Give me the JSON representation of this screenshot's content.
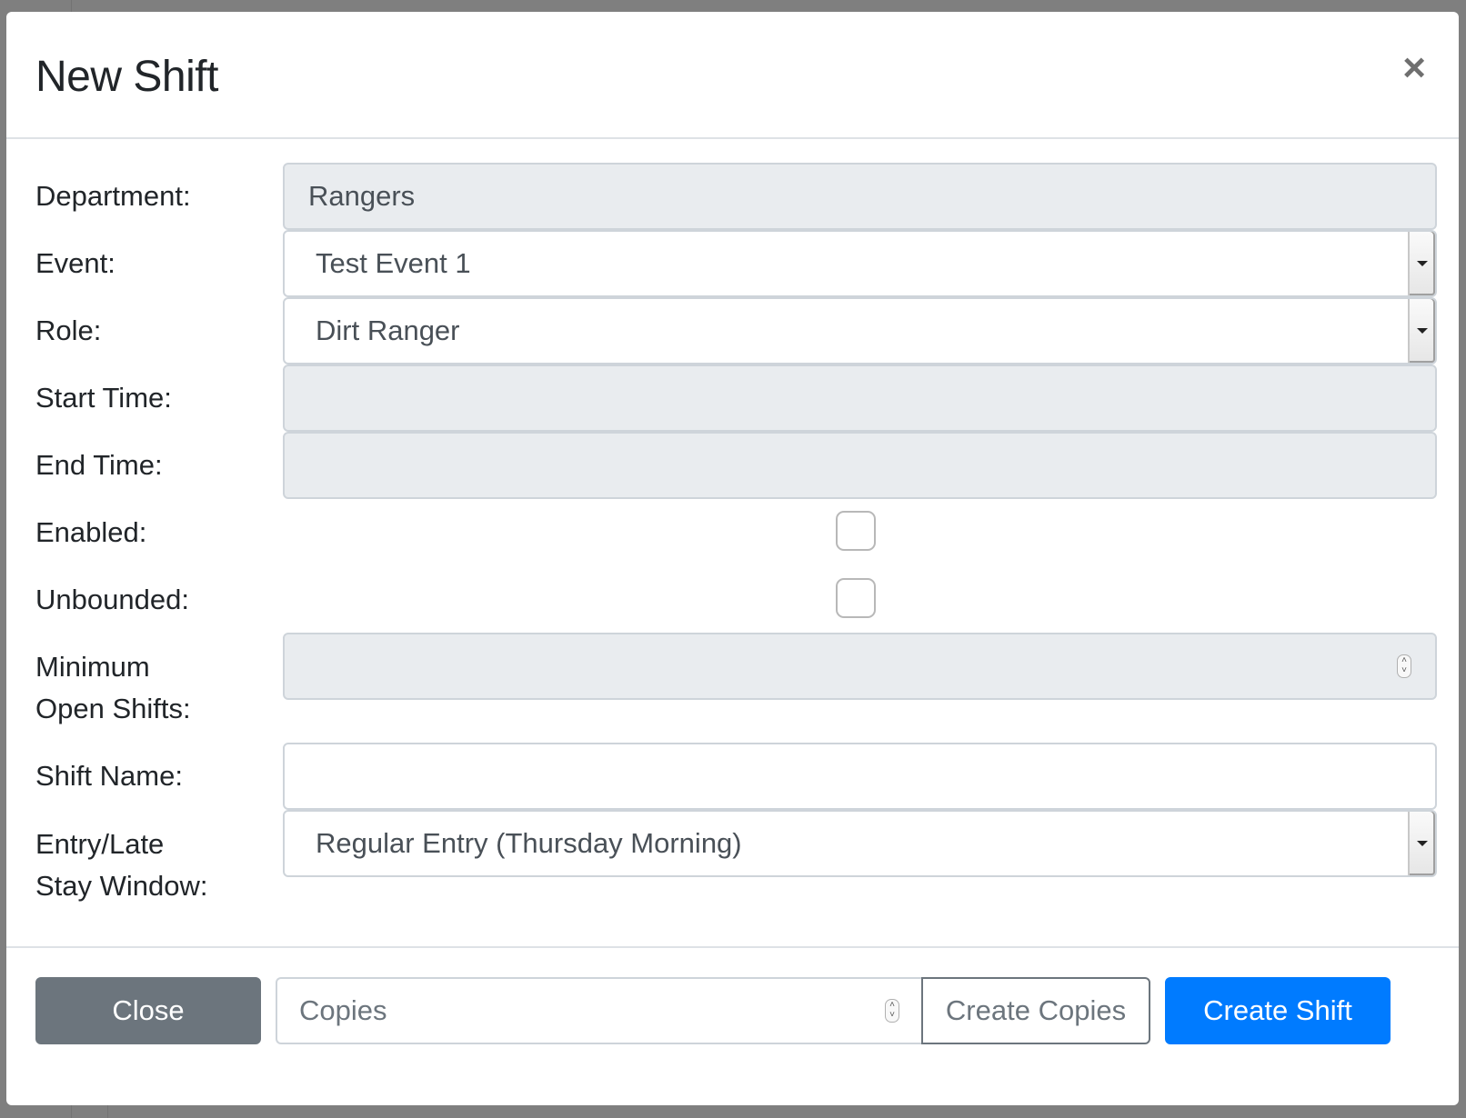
{
  "modal": {
    "title": "New Shift",
    "close_glyph": "×"
  },
  "form": {
    "department": {
      "label": "Department:",
      "value": "Rangers"
    },
    "event": {
      "label": "Event:",
      "value": "Test Event 1"
    },
    "role": {
      "label": "Role:",
      "value": "Dirt Ranger"
    },
    "start_time": {
      "label": "Start Time:",
      "value": ""
    },
    "end_time": {
      "label": "End Time:",
      "value": ""
    },
    "enabled": {
      "label": "Enabled:",
      "checked": false
    },
    "unbounded": {
      "label": "Unbounded:",
      "checked": false
    },
    "minimum_open_shifts": {
      "label_line1": "Minimum",
      "label_line2": "Open Shifts:",
      "value": ""
    },
    "shift_name": {
      "label": "Shift Name:",
      "value": ""
    },
    "entry_window": {
      "label_line1": "Entry/Late",
      "label_line2": "Stay Window:",
      "value": "Regular Entry (Thursday Morning)"
    }
  },
  "footer": {
    "close_label": "Close",
    "copies_placeholder": "Copies",
    "create_copies_label": "Create Copies",
    "create_shift_label": "Create Shift"
  },
  "colors": {
    "primary": "#007bff",
    "secondary": "#6c757d",
    "disabled_field": "#e9ecef"
  }
}
